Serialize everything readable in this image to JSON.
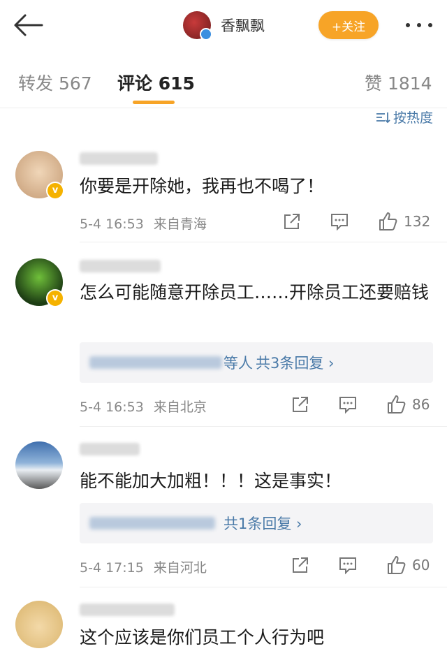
{
  "header": {
    "brand_name": "香飘飘",
    "follow_label": "+关注",
    "icons": [
      "back-arrow-icon",
      "more-icon"
    ]
  },
  "tabs": [
    {
      "label": "转发 567"
    },
    {
      "label": "评论 615"
    },
    {
      "label": "赞 1814"
    }
  ],
  "sort_label": "按热度",
  "comments": [
    {
      "text": "你要是开除她，我再也不喝了！",
      "time": "5-4 16:53",
      "location": "来自青海",
      "likes": "132"
    },
    {
      "text": "怎么可能随意开除员工……开除员工还要赔钱",
      "reply_suffix": "等人",
      "reply_count": "共3条回复 ›",
      "time": "5-4 16:53",
      "location": "来自北京",
      "likes": "86"
    },
    {
      "text": "能不能加大加粗！！！这是事实！",
      "reply_count": "共1条回复 ›",
      "time": "5-4 17:15",
      "location": "来自河北",
      "likes": "60"
    },
    {
      "text": "这个应该是你们员工个人行为吧"
    }
  ],
  "colors": {
    "accent": "#f7a427",
    "link": "#4a7aa8",
    "verified": "#f5b200"
  }
}
